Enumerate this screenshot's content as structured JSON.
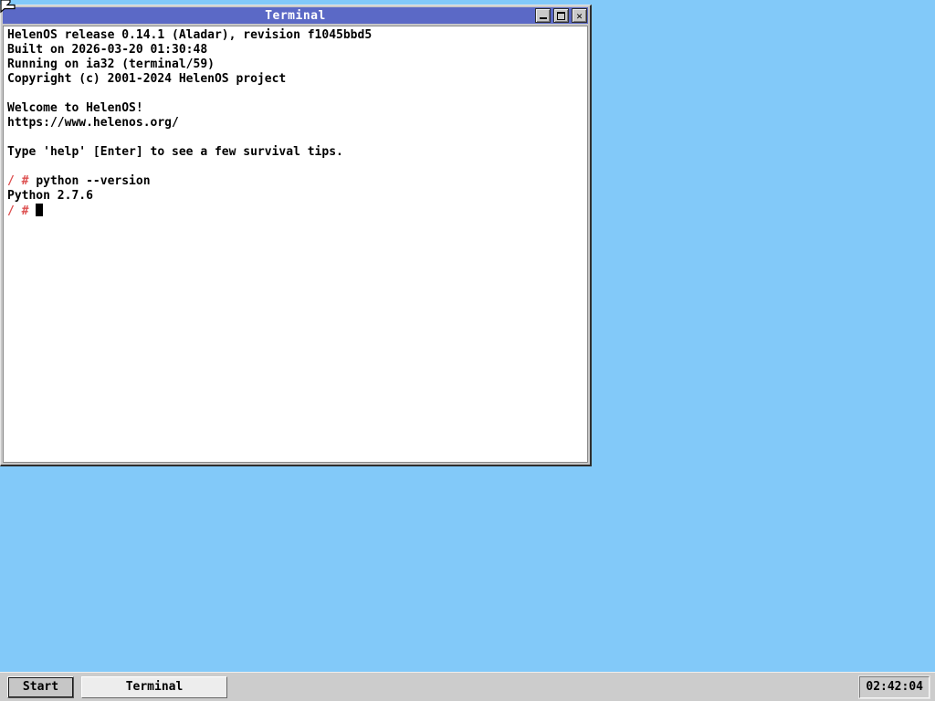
{
  "colors": {
    "desktop": "#82c9f9",
    "titlebar": "#5b69c6",
    "taskbar": "#cccccc",
    "terminal_bg": "#ffffff",
    "terminal_fg": "#000000",
    "prompt_red": "#dd4f4f"
  },
  "window": {
    "title": "Terminal",
    "controls": {
      "minimize_icon": "minimize",
      "maximize_icon": "maximize",
      "close_icon": "close"
    }
  },
  "terminal": {
    "lines": [
      {
        "segments": [
          {
            "t": "HelenOS release 0.14.1 (Aladar), revision f1045bbd5",
            "c": "fg"
          }
        ]
      },
      {
        "segments": [
          {
            "t": "Built on 2026-03-20 01:30:48",
            "c": "fg"
          }
        ]
      },
      {
        "segments": [
          {
            "t": "Running on ia32 (terminal/59)",
            "c": "fg"
          }
        ]
      },
      {
        "segments": [
          {
            "t": "Copyright (c) 2001-2024 HelenOS project",
            "c": "fg"
          }
        ]
      },
      {
        "segments": [
          {
            "t": "",
            "c": "fg"
          }
        ]
      },
      {
        "segments": [
          {
            "t": "Welcome to HelenOS!",
            "c": "fg"
          }
        ]
      },
      {
        "segments": [
          {
            "t": "https://www.helenos.org/",
            "c": "fg"
          }
        ]
      },
      {
        "segments": [
          {
            "t": "",
            "c": "fg"
          }
        ]
      },
      {
        "segments": [
          {
            "t": "Type 'help' [Enter] to see a few survival tips.",
            "c": "fg"
          }
        ]
      },
      {
        "segments": [
          {
            "t": "",
            "c": "fg"
          }
        ]
      },
      {
        "segments": [
          {
            "t": "/ # ",
            "c": "prompt"
          },
          {
            "t": "python --version",
            "c": "fg"
          }
        ]
      },
      {
        "segments": [
          {
            "t": "Python 2.7.6",
            "c": "fg"
          }
        ]
      },
      {
        "segments": [
          {
            "t": "/ # ",
            "c": "prompt"
          }
        ],
        "cursor": true
      }
    ]
  },
  "taskbar": {
    "start_label": "Start",
    "buttons": [
      {
        "label": "Terminal"
      }
    ],
    "clock": "02:42:04"
  }
}
